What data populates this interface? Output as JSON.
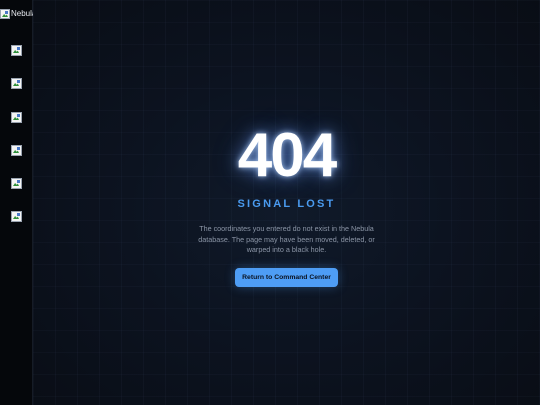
{
  "sidebar": {
    "logo_alt": "Nebula",
    "items": [
      {
        "icon": "nav-icon-1"
      },
      {
        "icon": "nav-icon-2"
      },
      {
        "icon": "nav-icon-3"
      },
      {
        "icon": "nav-icon-4"
      },
      {
        "icon": "nav-icon-5"
      },
      {
        "icon": "nav-icon-6"
      }
    ]
  },
  "error": {
    "code": "404",
    "title": "SIGNAL LOST",
    "description": "The coordinates you entered do not exist in the Nebula database. The page may have been moved, deleted, or warped into a black hole.",
    "button_label": "Return to Command Center"
  },
  "colors": {
    "accent": "#4e9df5",
    "title": "#4a9bf0",
    "background": "#0b1018",
    "sidebar": "#05070b"
  }
}
